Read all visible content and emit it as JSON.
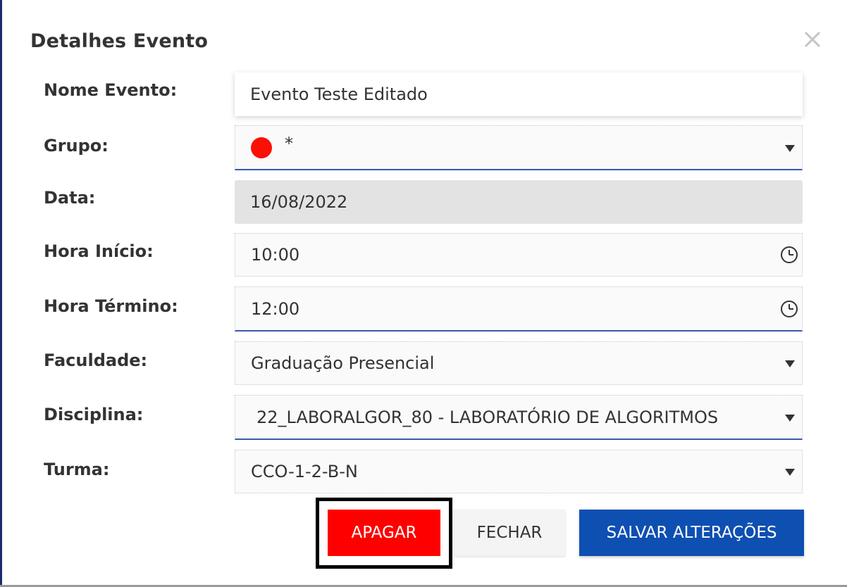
{
  "dialog": {
    "title": "Detalhes Evento",
    "close_icon": "close-icon"
  },
  "fields": {
    "nome_evento": {
      "label": "Nome Evento:",
      "value": "Evento Teste Editado"
    },
    "grupo": {
      "label": "Grupo:",
      "value": "*",
      "color": "#fb1005"
    },
    "data": {
      "label": "Data:",
      "value": "16/08/2022"
    },
    "hora_inicio": {
      "label": "Hora Início:",
      "value": "10:00"
    },
    "hora_termino": {
      "label": "Hora Término:",
      "value": "12:00"
    },
    "faculdade": {
      "label": "Faculdade:",
      "value": "Graduação Presencial"
    },
    "disciplina": {
      "label": "Disciplina:",
      "value": "22_LABORALGOR_80 - LABORATÓRIO DE ALGORITMOS"
    },
    "turma": {
      "label": "Turma:",
      "value": "CCO-1-2-B-N"
    }
  },
  "buttons": {
    "apagar": "APAGAR",
    "fechar": "FECHAR",
    "salvar": "SALVAR ALTERAÇÕES"
  },
  "colors": {
    "accent_blue": "#0e4fb2",
    "danger_red": "#ff0000",
    "focus_line": "#3a57b2"
  }
}
